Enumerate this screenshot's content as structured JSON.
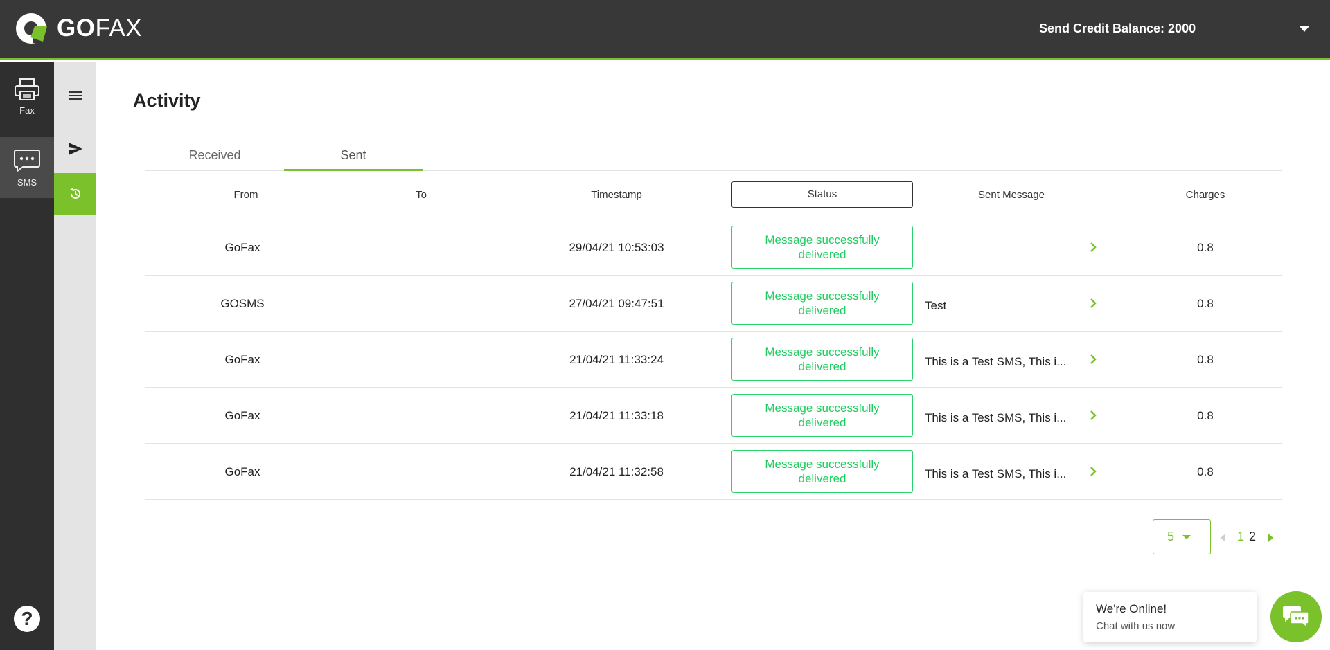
{
  "brand": {
    "go": "GO",
    "fax": "FAX",
    "accent": "#7ac12b",
    "status_green": "#1fcc5f"
  },
  "header": {
    "credit_label": "Send Credit Balance: 2000",
    "dropdown_icon": "chevron-down-icon"
  },
  "rail": {
    "items": [
      {
        "label": "Fax",
        "icon": "printer-icon"
      },
      {
        "label": "SMS",
        "icon": "chat-bubble-icon"
      }
    ],
    "help_label": "?"
  },
  "page": {
    "title": "Activity",
    "tabs": [
      {
        "label": "Received",
        "active": false
      },
      {
        "label": "Sent",
        "active": true
      }
    ]
  },
  "table": {
    "headers": {
      "from": "From",
      "to": "To",
      "timestamp": "Timestamp",
      "status": "Status",
      "message": "Sent Message",
      "charges": "Charges"
    },
    "rows": [
      {
        "from": "GoFax",
        "to": "",
        "timestamp": "29/04/21 10:53:03",
        "status": "Message successfully delivered",
        "message": "",
        "charges": "0.8"
      },
      {
        "from": "GOSMS",
        "to": "",
        "timestamp": "27/04/21 09:47:51",
        "status": "Message successfully delivered",
        "message": "Test",
        "charges": "0.8"
      },
      {
        "from": "GoFax",
        "to": "",
        "timestamp": "21/04/21 11:33:24",
        "status": "Message successfully delivered",
        "message": "This is a Test SMS, This i...",
        "charges": "0.8"
      },
      {
        "from": "GoFax",
        "to": "",
        "timestamp": "21/04/21 11:33:18",
        "status": "Message successfully delivered",
        "message": "This is a Test SMS, This i...",
        "charges": "0.8"
      },
      {
        "from": "GoFax",
        "to": "",
        "timestamp": "21/04/21 11:32:58",
        "status": "Message successfully delivered",
        "message": "This is a Test SMS, This i...",
        "charges": "0.8"
      }
    ]
  },
  "pagination": {
    "page_size": "5",
    "pages": [
      "1",
      "2"
    ],
    "current": "1"
  },
  "chat": {
    "title": "We're Online!",
    "subtitle": "Chat with us now"
  }
}
